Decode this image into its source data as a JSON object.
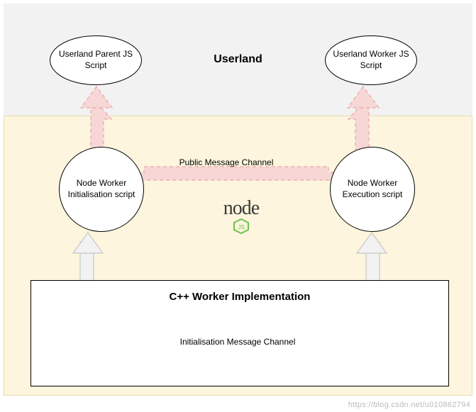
{
  "userland": {
    "title": "Userland",
    "parent_ellipse": "Userland Parent JS Script",
    "worker_ellipse": "Userland Worker JS Script"
  },
  "node": {
    "init_circle": "Node Worker Initialisation script",
    "exec_circle": "Node Worker Execution script",
    "logo_text": "node",
    "logo_sub": "JS"
  },
  "cpp": {
    "title": "C++ Worker Implementation"
  },
  "labels": {
    "public_channel": "Public Message Channel",
    "init_channel": "Initialisation Message Channel"
  },
  "watermark": "https://blog.csdn.net/u010862794",
  "colors": {
    "userland_bg": "#f2f2f2",
    "node_bg": "#fdf5dd",
    "pink_stroke": "#f2b7b7",
    "pink_fill": "#f7d6d6",
    "grey_stroke": "#c7c7c7",
    "grey_fill": "#f2f2f2"
  }
}
